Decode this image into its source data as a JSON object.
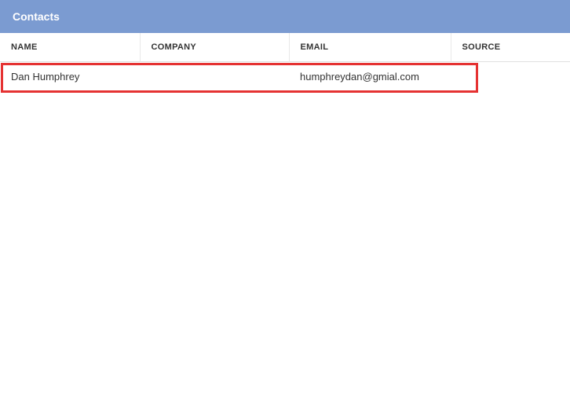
{
  "header": {
    "title": "Contacts"
  },
  "table": {
    "columns": {
      "name": "NAME",
      "company": "COMPANY",
      "email": "EMAIL",
      "source": "SOURCE"
    },
    "rows": [
      {
        "name": "Dan Humphrey",
        "company": "",
        "email": "humphreydan@gmial.com",
        "source": ""
      }
    ]
  }
}
